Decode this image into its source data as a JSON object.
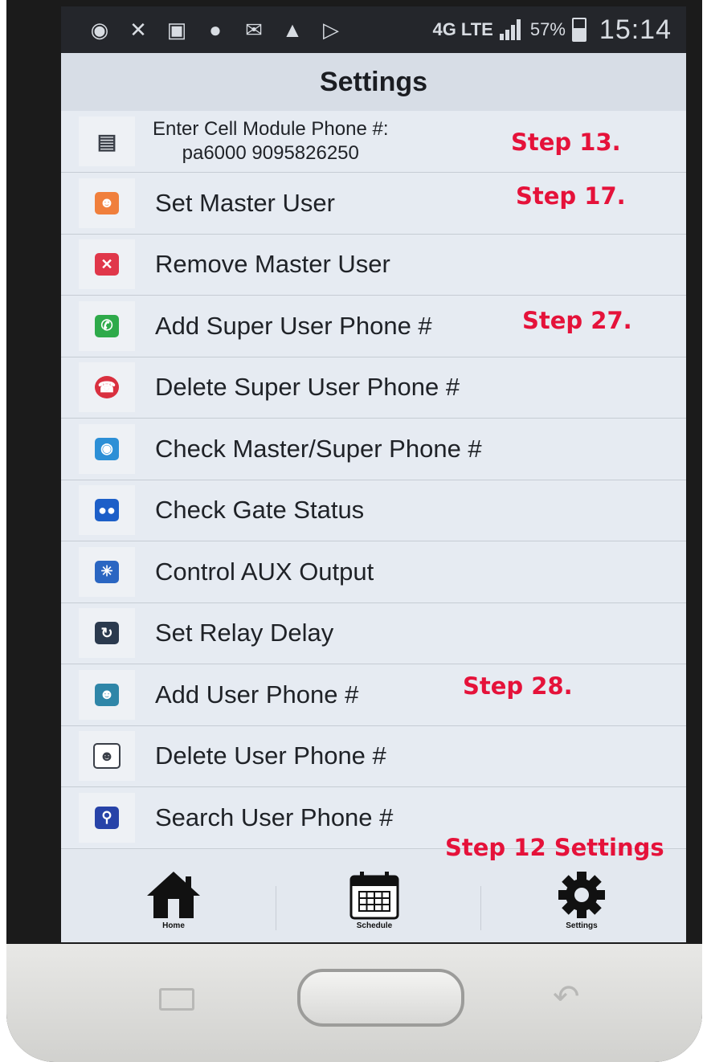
{
  "status_bar": {
    "icons": [
      "wechat-icon",
      "missed-call-icon",
      "voicemail-icon",
      "alert-chat-icon",
      "mail-icon",
      "warning-icon",
      "play-store-icon"
    ],
    "network": "4G LTE",
    "battery": "57%",
    "time": "15:14"
  },
  "title": "Settings",
  "menu": {
    "cell_module_line1": "Enter Cell Module Phone #:",
    "cell_module_line2": "pa6000 9095826250",
    "items": [
      {
        "label": "Set Master User",
        "icon": "user-icon",
        "color": "#f07f3c"
      },
      {
        "label": "Remove Master User",
        "icon": "close-icon",
        "color": "#e0374a"
      },
      {
        "label": "Add Super User Phone #",
        "icon": "phone-icon",
        "color": "#2eaa4a"
      },
      {
        "label": "Delete Super User Phone #",
        "icon": "delete-phone-icon",
        "color": "#d9303f"
      },
      {
        "label": "Check Master/Super Phone #",
        "icon": "eye-icon",
        "color": "#2c8fd6"
      },
      {
        "label": "Check Gate Status",
        "icon": "status-icon",
        "color": "#1d5fc8"
      },
      {
        "label": "Control AUX Output",
        "icon": "aux-icon",
        "color": "#2a66c2"
      },
      {
        "label": "Set Relay Delay",
        "icon": "timer-icon",
        "color": "#2b3a4e"
      },
      {
        "label": "Add User Phone #",
        "icon": "add-user-icon",
        "color": "#2f86a8"
      },
      {
        "label": "Delete User Phone #",
        "icon": "delete-user-icon",
        "color": "#3a3f48"
      },
      {
        "label": "Search User Phone #",
        "icon": "search-icon",
        "color": "#2743a8"
      }
    ]
  },
  "annotations": {
    "step13": "Step 13.",
    "step17": "Step 17.",
    "step27": "Step 27.",
    "step28": "Step 28.",
    "step12": "Step 12 Settings"
  },
  "nav": {
    "home": "Home",
    "schedule": "Schedule",
    "settings": "Settings"
  }
}
